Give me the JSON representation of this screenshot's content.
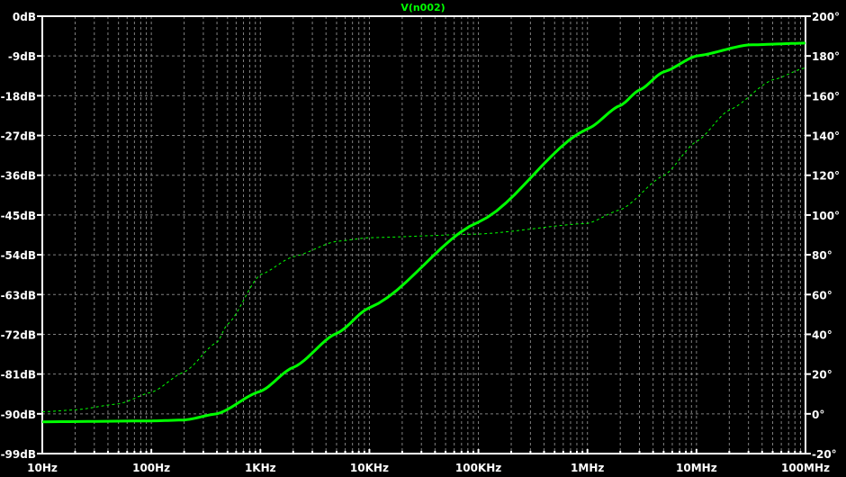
{
  "chart_data": {
    "type": "line",
    "title": "V(n002)",
    "x_scale": "log",
    "xlim": [
      10,
      100000000
    ],
    "x_ticks": [
      {
        "value": 10,
        "label": "10Hz"
      },
      {
        "value": 100,
        "label": "100Hz"
      },
      {
        "value": 1000,
        "label": "1KHz"
      },
      {
        "value": 10000,
        "label": "10KHz"
      },
      {
        "value": 100000,
        "label": "100KHz"
      },
      {
        "value": 1000000,
        "label": "1MHz"
      },
      {
        "value": 10000000,
        "label": "10MHz"
      },
      {
        "value": 100000000,
        "label": "100MHz"
      }
    ],
    "y_left": {
      "unit": "dB",
      "ylim": [
        -99,
        0
      ],
      "ticks": [
        {
          "value": 0,
          "label": "0dB"
        },
        {
          "value": -9,
          "label": "-9dB"
        },
        {
          "value": -18,
          "label": "-18dB"
        },
        {
          "value": -27,
          "label": "-27dB"
        },
        {
          "value": -36,
          "label": "-36dB"
        },
        {
          "value": -45,
          "label": "-45dB"
        },
        {
          "value": -54,
          "label": "-54dB"
        },
        {
          "value": -63,
          "label": "-63dB"
        },
        {
          "value": -72,
          "label": "-72dB"
        },
        {
          "value": -81,
          "label": "-81dB"
        },
        {
          "value": -90,
          "label": "-90dB"
        },
        {
          "value": -99,
          "label": "-99dB"
        }
      ]
    },
    "y_right": {
      "unit": "deg",
      "ylim": [
        -20,
        200
      ],
      "ticks": [
        {
          "value": 200,
          "label": "200°"
        },
        {
          "value": 180,
          "label": "180°"
        },
        {
          "value": 160,
          "label": "160°"
        },
        {
          "value": 140,
          "label": "140°"
        },
        {
          "value": 120,
          "label": "120°"
        },
        {
          "value": 100,
          "label": "100°"
        },
        {
          "value": 80,
          "label": "80°"
        },
        {
          "value": 60,
          "label": "60°"
        },
        {
          "value": 40,
          "label": "40°"
        },
        {
          "value": 20,
          "label": "20°"
        },
        {
          "value": 0,
          "label": "0°"
        },
        {
          "value": -20,
          "label": "-20°"
        }
      ]
    },
    "grid": true,
    "series": [
      {
        "axis": "left",
        "style": "solid",
        "color": "#00ff00",
        "x": [
          10,
          100,
          200,
          400,
          1000,
          2000,
          5000,
          10000,
          100000,
          1000000,
          2000000,
          3000000,
          5000000,
          10000000,
          30000000,
          100000000
        ],
        "y": [
          -91.8,
          -91.6,
          -91.4,
          -90.0,
          -84.9,
          -79.5,
          -71.8,
          -66.0,
          -46.6,
          -25.5,
          -20.2,
          -16.7,
          -12.6,
          -9.0,
          -6.5,
          -6.1
        ]
      },
      {
        "axis": "right",
        "style": "dashed",
        "color": "#00ff00",
        "x": [
          10,
          20,
          50,
          100,
          200,
          400,
          500,
          1000,
          2000,
          5000,
          10000,
          100000,
          1000000,
          2000000,
          5000000,
          10000000,
          20000000,
          50000000,
          100000000
        ],
        "y": [
          1,
          2,
          5,
          10.8,
          21,
          36,
          45,
          70,
          79,
          86.8,
          88.6,
          90.4,
          95.8,
          102.6,
          119.8,
          137,
          152.8,
          168,
          174
        ]
      }
    ]
  },
  "colors": {
    "background": "#000000",
    "trace": "#00ff00",
    "axes": "#ffffff",
    "grid": "#808080"
  }
}
